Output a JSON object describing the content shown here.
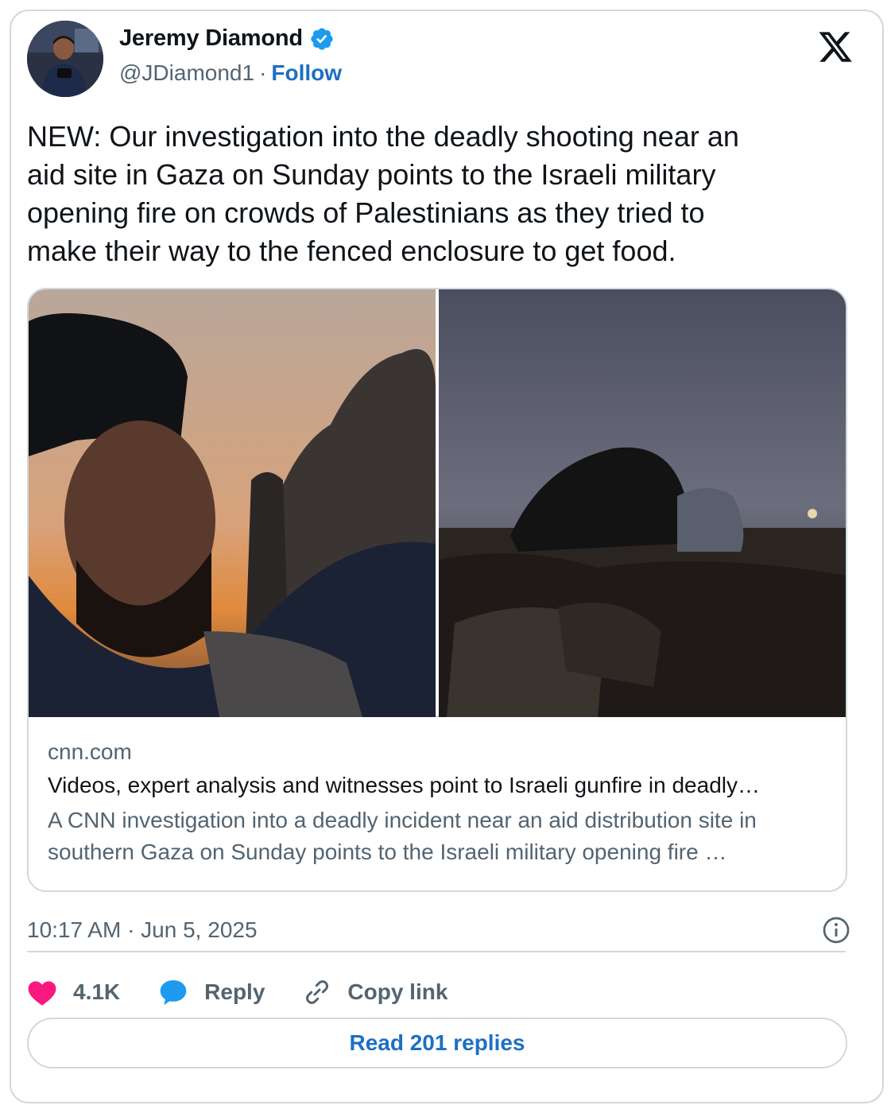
{
  "author": {
    "display_name": "Jeremy Diamond",
    "handle": "@JDiamond1",
    "separator": "·",
    "follow_label": "Follow",
    "verified": true
  },
  "icons": {
    "verified": "verified-badge-icon",
    "logo": "x-logo-icon",
    "info": "info-icon",
    "like": "heart-icon",
    "reply": "speech-bubble-icon",
    "copy": "link-icon"
  },
  "tweet": {
    "text": "NEW: Our investigation into the deadly shooting near an\naid site in Gaza on Sunday points to the Israeli military\nopening fire on crowds of Palestinians as they tried to\nmake their way to the fenced enclosure to get food."
  },
  "link_card": {
    "domain": "cnn.com",
    "title": "Videos, expert analysis and witnesses point to Israeli gunfire in deadly…",
    "description": "A CNN investigation into a deadly incident near an aid distribution site in southern Gaza on Sunday points to the Israeli military opening fire …"
  },
  "timestamp": "10:17 AM · Jun 5, 2025",
  "actions": {
    "likes": "4.1K",
    "reply_label": "Reply",
    "copy_label": "Copy link"
  },
  "read_replies_label": "Read 201 replies",
  "colors": {
    "accent": "#1d6fc4",
    "verified": "#1d9bf0",
    "heart": "#f91880",
    "muted": "#536471",
    "border": "#cfd9de"
  }
}
